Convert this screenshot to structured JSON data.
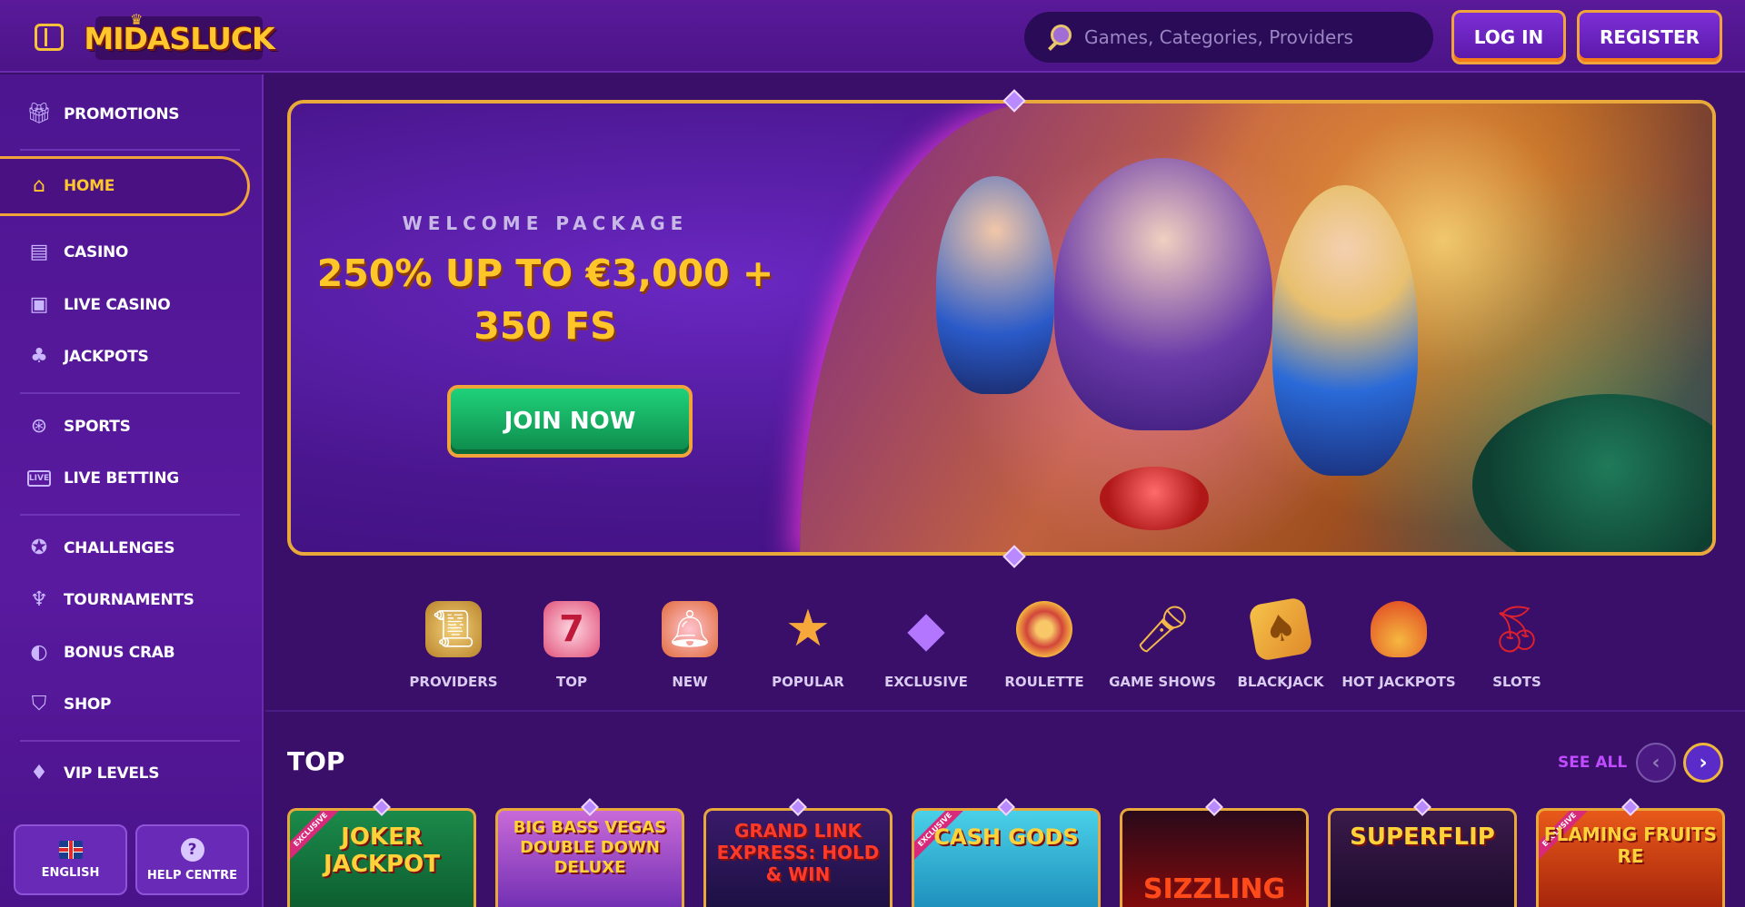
{
  "header": {
    "logo_text": "MIDASLUCK",
    "search_placeholder": "Games, Categories, Providers",
    "login_label": "LOG IN",
    "register_label": "REGISTER"
  },
  "sidebar": {
    "items": [
      {
        "label": "PROMOTIONS",
        "icon": "gift-icon"
      },
      {
        "label": "HOME",
        "icon": "home-icon",
        "active": true
      },
      {
        "label": "CASINO",
        "icon": "slot-machine-icon"
      },
      {
        "label": "LIVE CASINO",
        "icon": "live-casino-icon"
      },
      {
        "label": "JACKPOTS",
        "icon": "clover-icon"
      },
      {
        "label": "SPORTS",
        "icon": "ball-icon"
      },
      {
        "label": "LIVE BETTING",
        "icon": "live-icon"
      },
      {
        "label": "CHALLENGES",
        "icon": "badge-icon"
      },
      {
        "label": "TOURNAMENTS",
        "icon": "trophy-icon"
      },
      {
        "label": "BONUS CRAB",
        "icon": "crab-icon"
      },
      {
        "label": "SHOP",
        "icon": "basket-icon"
      },
      {
        "label": "VIP LEVELS",
        "icon": "diamond-icon"
      }
    ],
    "language_label": "ENGLISH",
    "help_label": "HELP CENTRE"
  },
  "banner": {
    "subtitle": "WELCOME PACKAGE",
    "headline_line1": "250% UP TO €3,000 +",
    "headline_line2": "350 FS",
    "cta_label": "JOIN NOW"
  },
  "categories": [
    {
      "label": "PROVIDERS",
      "icon": "scroll-icon"
    },
    {
      "label": "TOP",
      "icon": "crown-seven-icon"
    },
    {
      "label": "NEW",
      "icon": "bell-icon"
    },
    {
      "label": "POPULAR",
      "icon": "star-icon"
    },
    {
      "label": "EXCLUSIVE",
      "icon": "gem-icon"
    },
    {
      "label": "ROULETTE",
      "icon": "roulette-icon"
    },
    {
      "label": "GAME SHOWS",
      "icon": "microphone-icon"
    },
    {
      "label": "BLACKJACK",
      "icon": "cards-icon"
    },
    {
      "label": "HOT JACKPOTS",
      "icon": "fire-pot-icon"
    },
    {
      "label": "SLOTS",
      "icon": "cherries-icon"
    }
  ],
  "top_section": {
    "title": "TOP",
    "see_all_label": "SEE ALL",
    "games": [
      {
        "title": "JOKER JACKPOT",
        "exclusive": true
      },
      {
        "title": "BIG BASS VEGAS DOUBLE DOWN DELUXE",
        "exclusive": false
      },
      {
        "title": "GRAND LINK EXPRESS: HOLD & WIN",
        "exclusive": false
      },
      {
        "title": "CASH GODS",
        "exclusive": true
      },
      {
        "title": "SIZZLING",
        "exclusive": false
      },
      {
        "title": "SUPERFLIP",
        "exclusive": false
      },
      {
        "title": "FLAMING FRUITS RE",
        "exclusive": true
      }
    ],
    "exclusive_tag": "EXCLUSIVE"
  },
  "colors": {
    "accent_gold": "#ffc72c",
    "border_orange": "#f0a43a",
    "bg_purple": "#3a0f6a",
    "cta_green": "#1fd17a",
    "see_all_purple": "#c04cff"
  }
}
